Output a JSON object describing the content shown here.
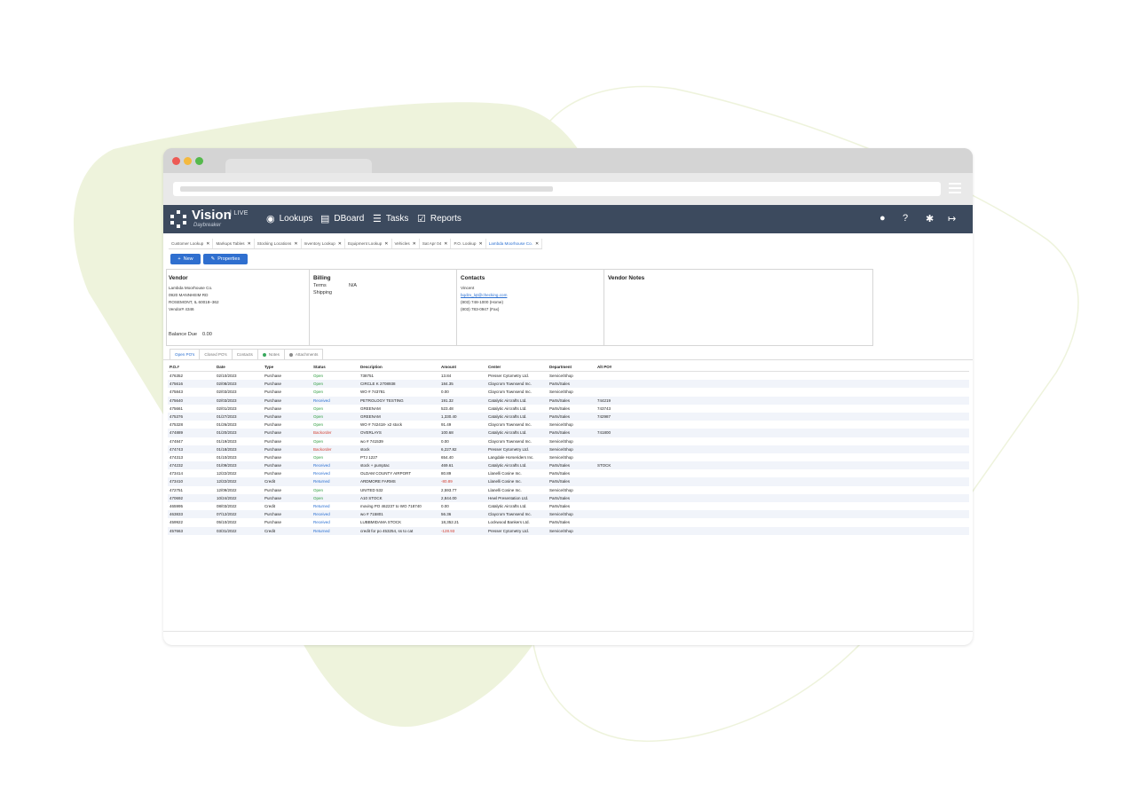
{
  "nav": {
    "brand": "Vision",
    "brand_live": "| LIVE",
    "brand_sub": "Daybreaker",
    "items": [
      {
        "label": "Lookups",
        "icon": "eye-icon"
      },
      {
        "label": "DBoard",
        "icon": "dashboard-icon"
      },
      {
        "label": "Tasks",
        "icon": "list-icon"
      },
      {
        "label": "Reports",
        "icon": "clipboard-check-icon"
      }
    ],
    "right_icons": [
      "user-icon",
      "help-icon",
      "settings-icon",
      "logout-icon"
    ]
  },
  "tabs": [
    {
      "label": "Customer Lookup",
      "active": false
    },
    {
      "label": "Markups Tables",
      "active": false
    },
    {
      "label": "Stocking Locations",
      "active": false
    },
    {
      "label": "Inventory Lookup",
      "active": false
    },
    {
      "label": "Equipment Lookup",
      "active": false
    },
    {
      "label": "Vehicles",
      "active": false
    },
    {
      "label": "Sat Apr 04",
      "active": false
    },
    {
      "label": "P.O. Lookup",
      "active": false
    },
    {
      "label": "Lambda Moorhouse Co.",
      "active": true
    }
  ],
  "actions": {
    "new_label": "New",
    "properties_label": "Properties"
  },
  "vendor": {
    "title": "Vendor",
    "name": "Lambda Moorhouse Co.",
    "address1": "0920 MANNHEIM RD",
    "address2": "ROSEMONT, IL 60018–362",
    "vendor_no": "Vendor# 4346",
    "balance_label": "Balance Due",
    "balance_value": "0.00"
  },
  "billing": {
    "title": "Billing",
    "terms_label": "Terms",
    "terms_value": "N/A",
    "shipping_label": "Shipping"
  },
  "contacts": {
    "title": "Contacts",
    "name": "Vincent",
    "email": "bqdzx_lqt@checking.com",
    "phone_home": "(803) 748-1000 (Home)",
    "phone_fax": "(803) 783-0947 (Fax)"
  },
  "notes": {
    "title": "Vendor Notes"
  },
  "subtabs": [
    {
      "label": "Open PO's",
      "active": true,
      "dot": ""
    },
    {
      "label": "Closed PO's",
      "active": false,
      "dot": ""
    },
    {
      "label": "Contacts",
      "active": false,
      "dot": ""
    },
    {
      "label": "Notes",
      "active": false,
      "dot": "green"
    },
    {
      "label": "Attachments",
      "active": false,
      "dot": "gray"
    }
  ],
  "table": {
    "columns": [
      "P.O.#",
      "Date",
      "Type",
      "Status",
      "Description",
      "Amount",
      "Center",
      "Department",
      "Alt PO#"
    ],
    "rows": [
      [
        "476352",
        "02/10/2023",
        "Purchase",
        "Open",
        "738751",
        "13.84",
        "Presser Cytometry Ltd.",
        "Service/Shop",
        ""
      ],
      [
        "475616",
        "02/08/2023",
        "Purchase",
        "Open",
        "CIRCLE K 2708938",
        "184.35",
        "Claycrom Townsend Inc.",
        "Parts/Sales",
        ""
      ],
      [
        "475843",
        "02/03/2023",
        "Purchase",
        "Open",
        "WO # 743781",
        "0.00",
        "Claycrom Townsend Inc.",
        "Service/Shop",
        ""
      ],
      [
        "475640",
        "02/03/2023",
        "Purchase",
        "Received",
        "PETROLOGY TESTING",
        "191.32",
        "Catalytic Aircrafts Ltd.",
        "Parts/Sales",
        "744219"
      ],
      [
        "475661",
        "02/01/2023",
        "Purchase",
        "Open",
        "GREENAM",
        "523.48",
        "Catalytic Aircrafts Ltd.",
        "Parts/Sales",
        "743743"
      ],
      [
        "475376",
        "01/27/2023",
        "Purchase",
        "Open",
        "GREENAM",
        "1,330.40",
        "Catalytic Aircrafts Ltd.",
        "Parts/Sales",
        "742987"
      ],
      [
        "475328",
        "01/26/2023",
        "Purchase",
        "Open",
        "WO # 742418- x2 stock",
        "91.49",
        "Claycrom Townsend Inc.",
        "Service/Shop",
        ""
      ],
      [
        "474889",
        "01/20/2023",
        "Purchase",
        "Backorder",
        "OVERLAYS",
        "100.68",
        "Catalytic Aircrafts Ltd.",
        "Parts/Sales",
        "741800"
      ],
      [
        "474847",
        "01/19/2023",
        "Purchase",
        "Open",
        "wo # 741539",
        "0.00",
        "Claycrom Townsend Inc.",
        "Service/Shop",
        ""
      ],
      [
        "474743",
        "01/18/2023",
        "Purchase",
        "Backorder",
        "stock",
        "6,227.82",
        "Presser Cytometry Ltd.",
        "Service/Shop",
        ""
      ],
      [
        "474313",
        "01/10/2023",
        "Purchase",
        "Open",
        "PTJ 1227",
        "654.40",
        "Langdale Horseriders Inc.",
        "Service/Shop",
        ""
      ],
      [
        "474232",
        "01/09/2023",
        "Purchase",
        "Received",
        "stock + pumptac",
        "469.61",
        "Catalytic Aircrafts Ltd.",
        "Parts/Sales",
        "STOCK"
      ],
      [
        "473414",
        "12/22/2022",
        "Purchase",
        "Received",
        "OLDAM COUNTY AIRPORT",
        "80.89",
        "Llanelli Cosine Inc.",
        "Parts/Sales",
        ""
      ],
      [
        "473410",
        "12/22/2022",
        "Credit",
        "Returned",
        "ARDMORE FARMS",
        "-80.89",
        "Llanelli Cosine Inc.",
        "Parts/Sales",
        ""
      ],
      [
        "472751",
        "12/09/2022",
        "Purchase",
        "Open",
        "UNITED 532",
        "2,593.77",
        "Llanelli Cosine Inc.",
        "Service/Shop",
        ""
      ],
      [
        "470692",
        "10/24/2022",
        "Purchase",
        "Open",
        "A10 STOCK",
        "2,844.00",
        "Hewl Presentation Ltd.",
        "Parts/Sales",
        ""
      ],
      [
        "465995",
        "08/03/2022",
        "Credit",
        "Returned",
        "moving PO 462237 to WO 718740",
        "0.00",
        "Catalytic Aircrafts Ltd.",
        "Parts/Sales",
        ""
      ],
      [
        "463833",
        "07/12/2022",
        "Purchase",
        "Received",
        "wo # 715801",
        "56.36",
        "Claycrom Townsend Inc.",
        "Service/Shop",
        ""
      ],
      [
        "459922",
        "05/10/2022",
        "Purchase",
        "Received",
        "LUBBMIDAMA STOCK",
        "18,352.21",
        "Lockwood Bankers Ltd.",
        "Parts/Sales",
        ""
      ],
      [
        "457663",
        "03/31/2022",
        "Credit",
        "Returned",
        "credit for po 453254, ss to cat",
        "-128.93",
        "Presser Cytometry Ltd.",
        "Service/Shop",
        ""
      ]
    ]
  },
  "colors": {
    "navbar": "#3c4a5e",
    "accent": "#2f6fcf",
    "open": "#2e9c3f",
    "backorder": "#d23f31",
    "blob": "#eef3dc"
  }
}
